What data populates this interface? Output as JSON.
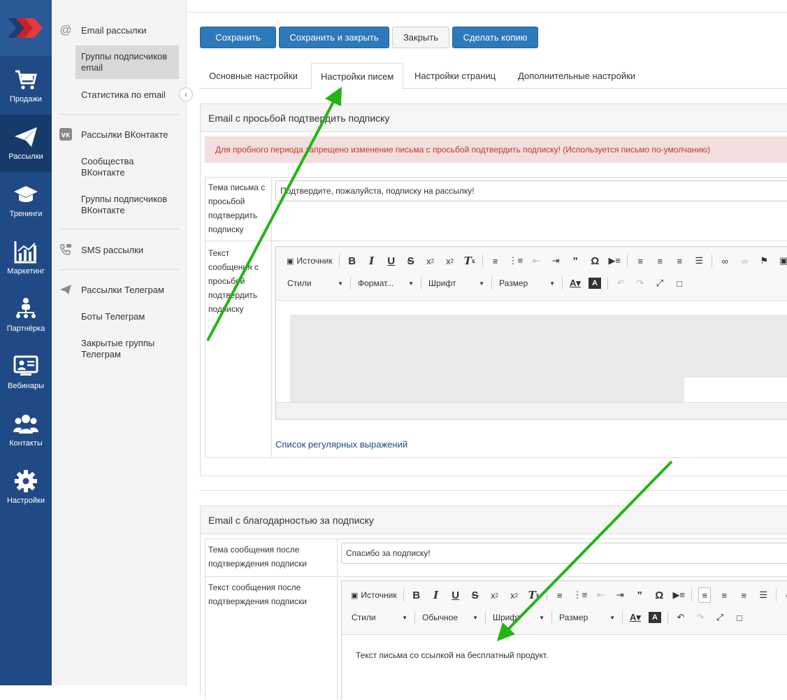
{
  "rail": {
    "items": [
      {
        "label": "Продажи",
        "icon": "cart-icon"
      },
      {
        "label": "Рассылки",
        "icon": "paper-plane-icon"
      },
      {
        "label": "Тренинги",
        "icon": "graduation-cap-icon"
      },
      {
        "label": "Маркетинг",
        "icon": "chart-icon"
      },
      {
        "label": "Партнёрка",
        "icon": "network-icon"
      },
      {
        "label": "Вебинары",
        "icon": "webinar-icon"
      },
      {
        "label": "Контакты",
        "icon": "users-icon"
      },
      {
        "label": "Настройки",
        "icon": "gear-icon"
      }
    ]
  },
  "submenu": {
    "email_head": "Email рассылки",
    "email_groups": "Группы подписчиков email",
    "email_stats": "Статистика по email",
    "vk_head": "Рассылки ВКонтакте",
    "vk_communities": "Сообщества ВКонтакте",
    "vk_groups": "Группы подписчиков ВКонтакте",
    "sms_head": "SMS рассылки",
    "tg_head": "Рассылки Телеграм",
    "tg_bots": "Боты Телеграм",
    "tg_closed": "Закрытые группы Телеграм"
  },
  "toolbar": {
    "save": "Сохранить",
    "save_close": "Сохранить и закрыть",
    "close": "Закрыть",
    "copy": "Сделать копию"
  },
  "tabs": [
    "Основные настройки",
    "Настройки писем",
    "Настройки страниц",
    "Дополнительные настройки"
  ],
  "confirm": {
    "title": "Email с просьбой подтвердить подписку",
    "alert": "Для пробного периода запрещено изменение письма с просьбой подтвердить подписку! (Используется письмо по-умолчанию)",
    "subject_label": "Тема письма с просьбой подтвердить подписку",
    "subject_value": "Подтвердите, пожалуйста, подписку на рассылку!",
    "body_label": "Текст сообщения с просьбой подтвердить подписку",
    "regex_link": "Список регулярных выражений",
    "editor": {
      "source": "Источник",
      "styles": "Стили",
      "format": "Формат...",
      "font": "Шрифт",
      "size": "Размер"
    }
  },
  "thanks": {
    "title": "Email с благодарностью за подписку",
    "subject_label": "Тема сообщения после подтверждения подписки",
    "subject_value": "Спасибо за подписку!",
    "body_label": "Текст сообщения после подтверждения подписки",
    "body_text": "Текст письма со ссылкой на бесплатный продукт.",
    "editor": {
      "source": "Источник",
      "styles": "Стили",
      "format": "Обычное",
      "font": "Шрифт",
      "size": "Размер"
    }
  },
  "colors": {
    "rail": "#1f4a85",
    "primary_button": "#2e79b9",
    "alert_bg": "#f2dede",
    "alert_text": "#c0392b",
    "annotation_arrow": "#22b514"
  }
}
